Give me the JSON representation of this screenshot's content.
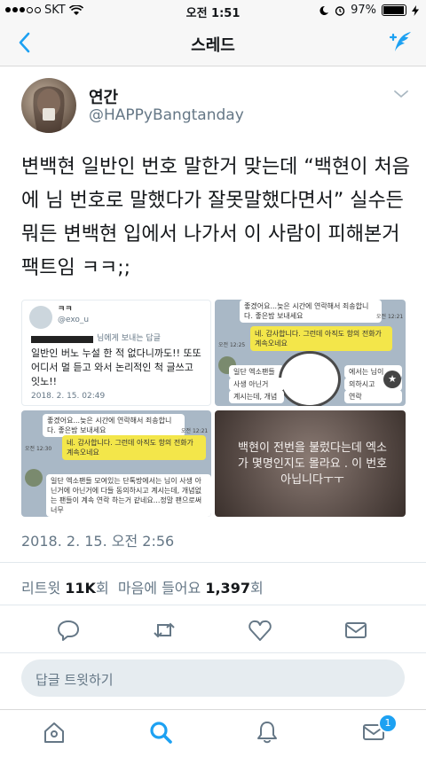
{
  "status_bar": {
    "carrier": "SKT",
    "time": "오전 1:51",
    "battery": "97%",
    "battery_level": 0.97
  },
  "nav": {
    "title": "스레드"
  },
  "tweet": {
    "display_name": "연간",
    "handle": "@HAPPyBangtanday",
    "text": "변백현 일반인 번호 말한거 맞는데 “백현이 처음에 님 번호로 말했다가 잘못말했다면서” 실수든 뭐든 변백현 입에서 나가서 이 사람이 피해본거 팩트임 ㅋㅋ;;",
    "timestamp": "2018. 2. 15. 오전 2:56"
  },
  "media": {
    "m1": {
      "name": "ㅋㅋ",
      "handle": "@exo_u",
      "reply_label": "님에게 보내는 답글",
      "body": "일반인 버노 누설 한 적 없다니까도!! 또또 어디서 멀 듣고 와서 논리적인 척 글쓰고 잇노!!",
      "time": "2018. 2. 15. 02:49"
    },
    "m2": {
      "msg1": "좋겠어요...늦은 시간에 연락해서 죄송합니다. 좋은밤 보내세요",
      "time1": "오전 12:21",
      "time2": "오전 12:25",
      "msg2": "네. 감사합니다. 그런데 아직도 항의 전화가 계속오네요",
      "msg3a": "일단 엑소팬들",
      "msg3b": "에서는 님이",
      "msg3c": "사생 아닌거",
      "msg3d": "의하시고",
      "msg3e": "계시는데, 개념",
      "msg3f": "연락"
    },
    "m3": {
      "msg1": "좋겠어요...늦은 시간에 연락해서 죄송합니다. 좋은밤 보내세요",
      "time1": "오전 12:21",
      "time2": "오전 12:30",
      "msg2": "네. 감사합니다. 그런데 아직도 항의 전화가 계속오네요",
      "msg3": "일단 엑소팬들 모여있는 단톡방에서는 님이 사생 아닌거에 아닌거에 다들 동의하시고 계시는데, 개념없는 팬들이 계속 연락 하는거 같네요...정말 팬으로써 너무"
    },
    "m4": {
      "text": "백현이 전번을 불렀다는데 엑소가 몇명인지도 몰라요 . 이 번호 아닙니다ㅜㅜ"
    }
  },
  "stats": {
    "retweets_label": "리트윗",
    "retweets_count": "11K",
    "retweets_unit": "회",
    "likes_label": "마음에 들어요",
    "likes_count": "1,397",
    "likes_unit": "회"
  },
  "reply": {
    "placeholder": "답글 트윗하기"
  },
  "tabbar": {
    "notifications_badge": "1"
  },
  "colors": {
    "accent": "#1da1f2",
    "secondary_text": "#657786",
    "divider": "#e1e8ed"
  }
}
